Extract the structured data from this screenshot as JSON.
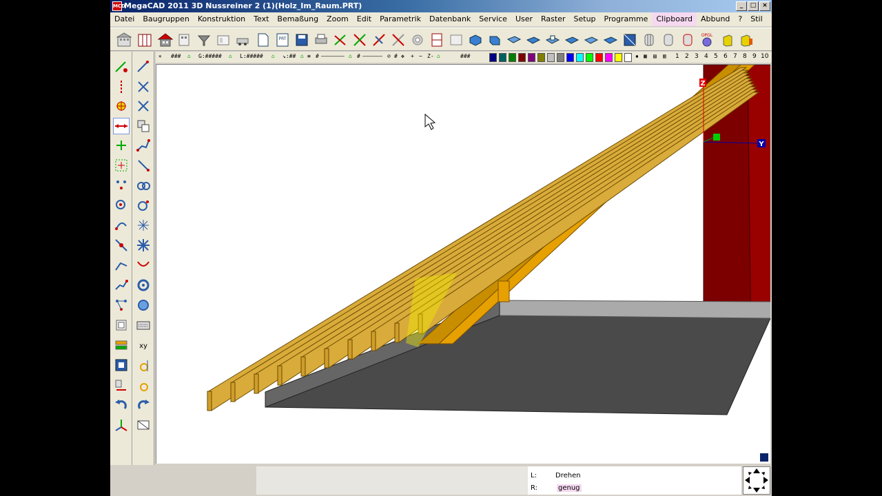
{
  "window": {
    "title": "MegaCAD 2011 3D Nussreiner 2 (1)(Holz_Im_Raum.PRT)",
    "icon_label": "MCD",
    "controls": {
      "minimize": "_",
      "maximize": "□",
      "close": "×"
    }
  },
  "menu": [
    {
      "label": "Datei"
    },
    {
      "label": "Baugruppen"
    },
    {
      "label": "Konstruktion"
    },
    {
      "label": "Text"
    },
    {
      "label": "Bemaßung"
    },
    {
      "label": "Zoom"
    },
    {
      "label": "Edit"
    },
    {
      "label": "Parametrik"
    },
    {
      "label": "Datenbank"
    },
    {
      "label": "Service"
    },
    {
      "label": "User"
    },
    {
      "label": "Raster"
    },
    {
      "label": "Setup"
    },
    {
      "label": "Programme"
    },
    {
      "label": "Clipboard"
    },
    {
      "label": "Abbund"
    },
    {
      "label": "?"
    },
    {
      "label": "Stil"
    }
  ],
  "toolbar": {
    "prt_label": "PRT",
    "opgl_label": "OPGL"
  },
  "options_row": {
    "grid": "###",
    "g_field": "G:#####",
    "l_field": "L:#####",
    "angle_field": "↘:##",
    "hash1": "#",
    "hash2": "#",
    "hash3": "#",
    "hash_right": "###",
    "minus": "−",
    "plus": "+",
    "zoom_field": "Z-",
    "layers": [
      "1",
      "2",
      "3",
      "4",
      "5",
      "6",
      "7",
      "8",
      "9",
      "10"
    ],
    "colors": [
      "#000080",
      "#006060",
      "#008000",
      "#800000",
      "#800080",
      "#808000",
      "#c0c0c0",
      "#808080",
      "#0000ff",
      "#00ffff",
      "#00ff00",
      "#ff0000",
      "#ff00ff",
      "#ffff00",
      "#ffffff"
    ]
  },
  "canvas": {
    "axis_z": "Z",
    "axis_y": "Y"
  },
  "status": {
    "l_label": "L:",
    "l_value": "Drehen",
    "r_label": "R:",
    "r_value": "genug"
  }
}
